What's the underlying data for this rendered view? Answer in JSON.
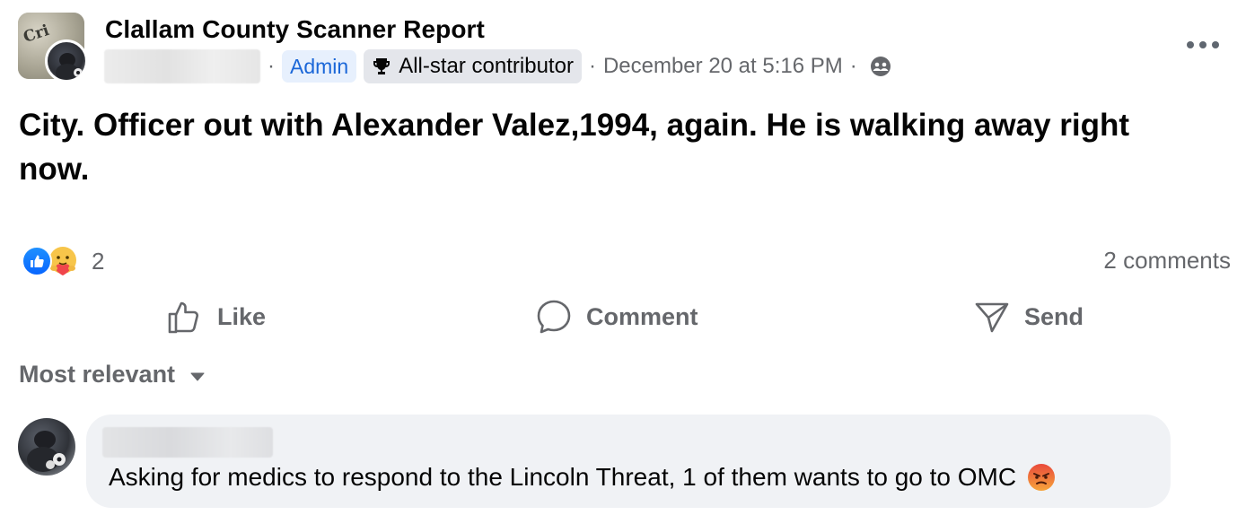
{
  "post": {
    "group_name": "Clallam County Scanner Report",
    "group_avatar_text": "Cri",
    "role_badge": "Admin",
    "contributor_badge": "All-star contributor",
    "separator": "·",
    "timestamp": "December 20 at 5:16 PM",
    "text": "City. Officer out with Alexander Valez,1994, again. He is walking away right now.",
    "more_icon": "more-horizontal-icon",
    "audience_icon": "members-icon"
  },
  "stats": {
    "reaction_count": "2",
    "comments_count": "2 comments",
    "reaction_icons": [
      "like-reaction-icon",
      "care-reaction-icon"
    ]
  },
  "actions": {
    "like": "Like",
    "comment": "Comment",
    "send": "Send"
  },
  "comments": {
    "sort_label": "Most relevant",
    "items": [
      {
        "text": "Asking for medics to respond to the Lincoln Threat, 1 of them wants to go to OMC",
        "reaction_emoji": "angry-face-icon"
      }
    ]
  },
  "colors": {
    "admin_badge_bg": "#e7f0fd",
    "admin_badge_text": "#1b67d8",
    "like_blue": "#0866ff",
    "secondary_text": "#65676b",
    "bubble_bg": "#f0f2f5"
  }
}
